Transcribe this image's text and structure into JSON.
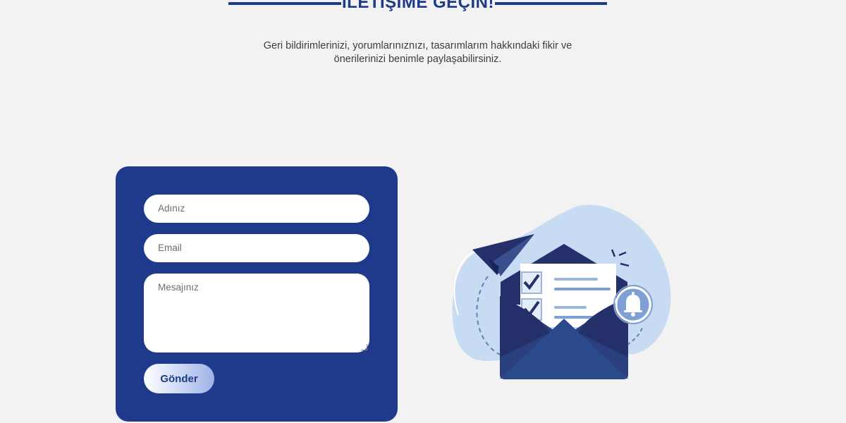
{
  "header": {
    "title": "İLETİŞİME GEÇİN!",
    "subtitle_line1": "Geri bildirimlerinizi, yorumlarınıznızı, tasarımlarım hakkındaki fikir ve",
    "subtitle_line2": "önerilerinizi benimle paylaşabilirsiniz."
  },
  "form": {
    "name_placeholder": "Adınız",
    "email_placeholder": "Email",
    "message_placeholder": "Mesajınız",
    "submit_label": "Gönder"
  },
  "colors": {
    "primary": "#1f3a8a",
    "background": "#f2f2f2",
    "illustration_light": "#c7dbf3",
    "illustration_dark": "#25306b"
  },
  "icons": [
    "paper-plane-icon",
    "envelope-icon",
    "checklist-icon",
    "bell-icon"
  ]
}
